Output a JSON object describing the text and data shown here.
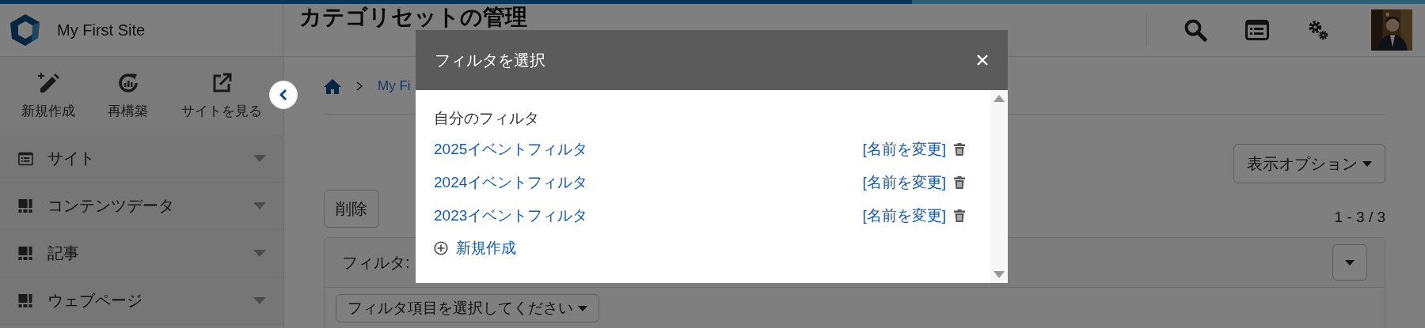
{
  "header": {
    "site_name": "My First Site",
    "page_title": "カテゴリセットの管理"
  },
  "sidebar": {
    "actions": [
      {
        "label": "新規作成",
        "kind": "create"
      },
      {
        "label": "再構築",
        "kind": "rebuild"
      },
      {
        "label": "サイトを見る",
        "kind": "view"
      }
    ],
    "items": [
      {
        "label": "サイト",
        "kind": "site"
      },
      {
        "label": "コンテンツデータ",
        "kind": "content"
      },
      {
        "label": "記事",
        "kind": "content"
      },
      {
        "label": "ウェブページ",
        "kind": "content"
      }
    ]
  },
  "breadcrumb": [
    "My Fi"
  ],
  "toolbar": {
    "display_options": "表示オプション",
    "delete": "削除",
    "count": "1 - 3 / 3"
  },
  "filter_panel": {
    "label": "フィルタ:",
    "select": "フィルタ項目を選択してください"
  },
  "modal": {
    "title": "フィルタを選択",
    "section": "自分のフィルタ",
    "filters": [
      {
        "name": "2025イベントフィルタ",
        "rename": "[名前を変更]"
      },
      {
        "name": "2024イベントフィルタ",
        "rename": "[名前を変更]"
      },
      {
        "name": "2023イベントフィルタ",
        "rename": "[名前を変更]"
      }
    ],
    "new": "新規作成"
  }
}
